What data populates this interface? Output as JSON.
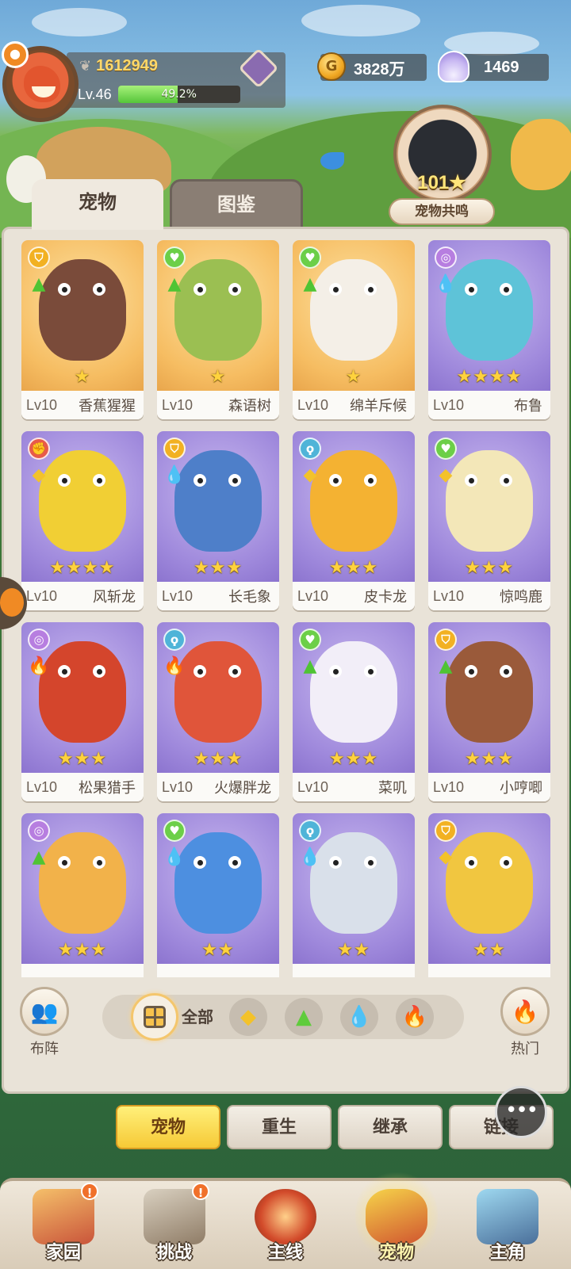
{
  "player": {
    "power": "1612949",
    "level": "Lv.46",
    "exp_percent_text": "49.2%",
    "exp_fraction": 0.492
  },
  "currency": {
    "coins": "3828万",
    "shells": "1469"
  },
  "resonance": {
    "level": "101",
    "label": "宠物共鸣"
  },
  "tabs": {
    "pets": "宠物",
    "codex": "图鉴"
  },
  "pets": [
    {
      "lv": "Lv10",
      "name": "香蕉猩猩",
      "stars": "★",
      "bg": "orange",
      "rarity": "shield",
      "rarity_color": "#f2b122",
      "element": "leaf",
      "color": "#7a4b3a"
    },
    {
      "lv": "Lv10",
      "name": "森语树",
      "stars": "★",
      "bg": "orange",
      "rarity": "heart",
      "rarity_color": "#6ccf48",
      "element": "leaf",
      "color": "#9bbf52"
    },
    {
      "lv": "Lv10",
      "name": "绵羊斥候",
      "stars": "★",
      "bg": "orange",
      "rarity": "heart",
      "rarity_color": "#6ccf48",
      "element": "leaf",
      "color": "#f4efe7"
    },
    {
      "lv": "Lv10",
      "name": "布鲁",
      "stars": "★★★★",
      "bg": "purple",
      "rarity": "spiral",
      "rarity_color": "#b77ee0",
      "element": "water",
      "color": "#5ec3d8"
    },
    {
      "lv": "Lv10",
      "name": "风斩龙",
      "stars": "★★★★",
      "bg": "purple",
      "rarity": "fist",
      "rarity_color": "#e85a4a",
      "element": "earth",
      "color": "#f1cf34"
    },
    {
      "lv": "Lv10",
      "name": "长毛象",
      "stars": "★★★",
      "bg": "purple",
      "rarity": "shield",
      "rarity_color": "#f2b122",
      "element": "water",
      "color": "#4e7fc9"
    },
    {
      "lv": "Lv10",
      "name": "皮卡龙",
      "stars": "★★★",
      "bg": "purple",
      "rarity": "hook",
      "rarity_color": "#4fb4d8",
      "element": "earth",
      "color": "#f4b232"
    },
    {
      "lv": "Lv10",
      "name": "惊鸣鹿",
      "stars": "★★★",
      "bg": "purple",
      "rarity": "heart",
      "rarity_color": "#6ccf48",
      "element": "earth",
      "color": "#f3e7b8"
    },
    {
      "lv": "Lv10",
      "name": "松果猎手",
      "stars": "★★★",
      "bg": "purple",
      "rarity": "spiral",
      "rarity_color": "#b77ee0",
      "element": "fire",
      "color": "#d4452c"
    },
    {
      "lv": "Lv10",
      "name": "火爆胖龙",
      "stars": "★★★",
      "bg": "purple",
      "rarity": "hook",
      "rarity_color": "#4fb4d8",
      "element": "fire",
      "color": "#e0553a"
    },
    {
      "lv": "Lv10",
      "name": "菜叽",
      "stars": "★★★",
      "bg": "purple",
      "rarity": "heart",
      "rarity_color": "#6ccf48",
      "element": "leaf",
      "color": "#f2eef8"
    },
    {
      "lv": "Lv10",
      "name": "小哼唧",
      "stars": "★★★",
      "bg": "purple",
      "rarity": "shield",
      "rarity_color": "#f2b122",
      "element": "leaf",
      "color": "#9a5a3a"
    },
    {
      "lv": "",
      "name": "",
      "stars": "★★★",
      "bg": "purple",
      "rarity": "spiral",
      "rarity_color": "#b77ee0",
      "element": "leaf",
      "color": "#f2b24a"
    },
    {
      "lv": "",
      "name": "",
      "stars": "★★",
      "bg": "purple",
      "rarity": "heart",
      "rarity_color": "#6ccf48",
      "element": "water",
      "color": "#4d8fe0"
    },
    {
      "lv": "",
      "name": "",
      "stars": "★★",
      "bg": "purple",
      "rarity": "hook",
      "rarity_color": "#4fb4d8",
      "element": "water",
      "color": "#d9e0ea"
    },
    {
      "lv": "",
      "name": "",
      "stars": "★★",
      "bg": "purple",
      "rarity": "shield",
      "rarity_color": "#f2b122",
      "element": "earth",
      "color": "#f1c640"
    }
  ],
  "filter": {
    "formation_label": "布阵",
    "all_label": "全部",
    "hot_label": "热门",
    "chips": [
      "earth-element-icon",
      "leaf-element-icon",
      "water-element-icon",
      "fire-element-icon"
    ]
  },
  "actions": {
    "pets": "宠物",
    "rebirth": "重生",
    "inherit": "继承",
    "link": "链接"
  },
  "nav": {
    "home": "家园",
    "challenge": "挑战",
    "main_line": "主线",
    "pets": "宠物",
    "hero": "主角"
  }
}
